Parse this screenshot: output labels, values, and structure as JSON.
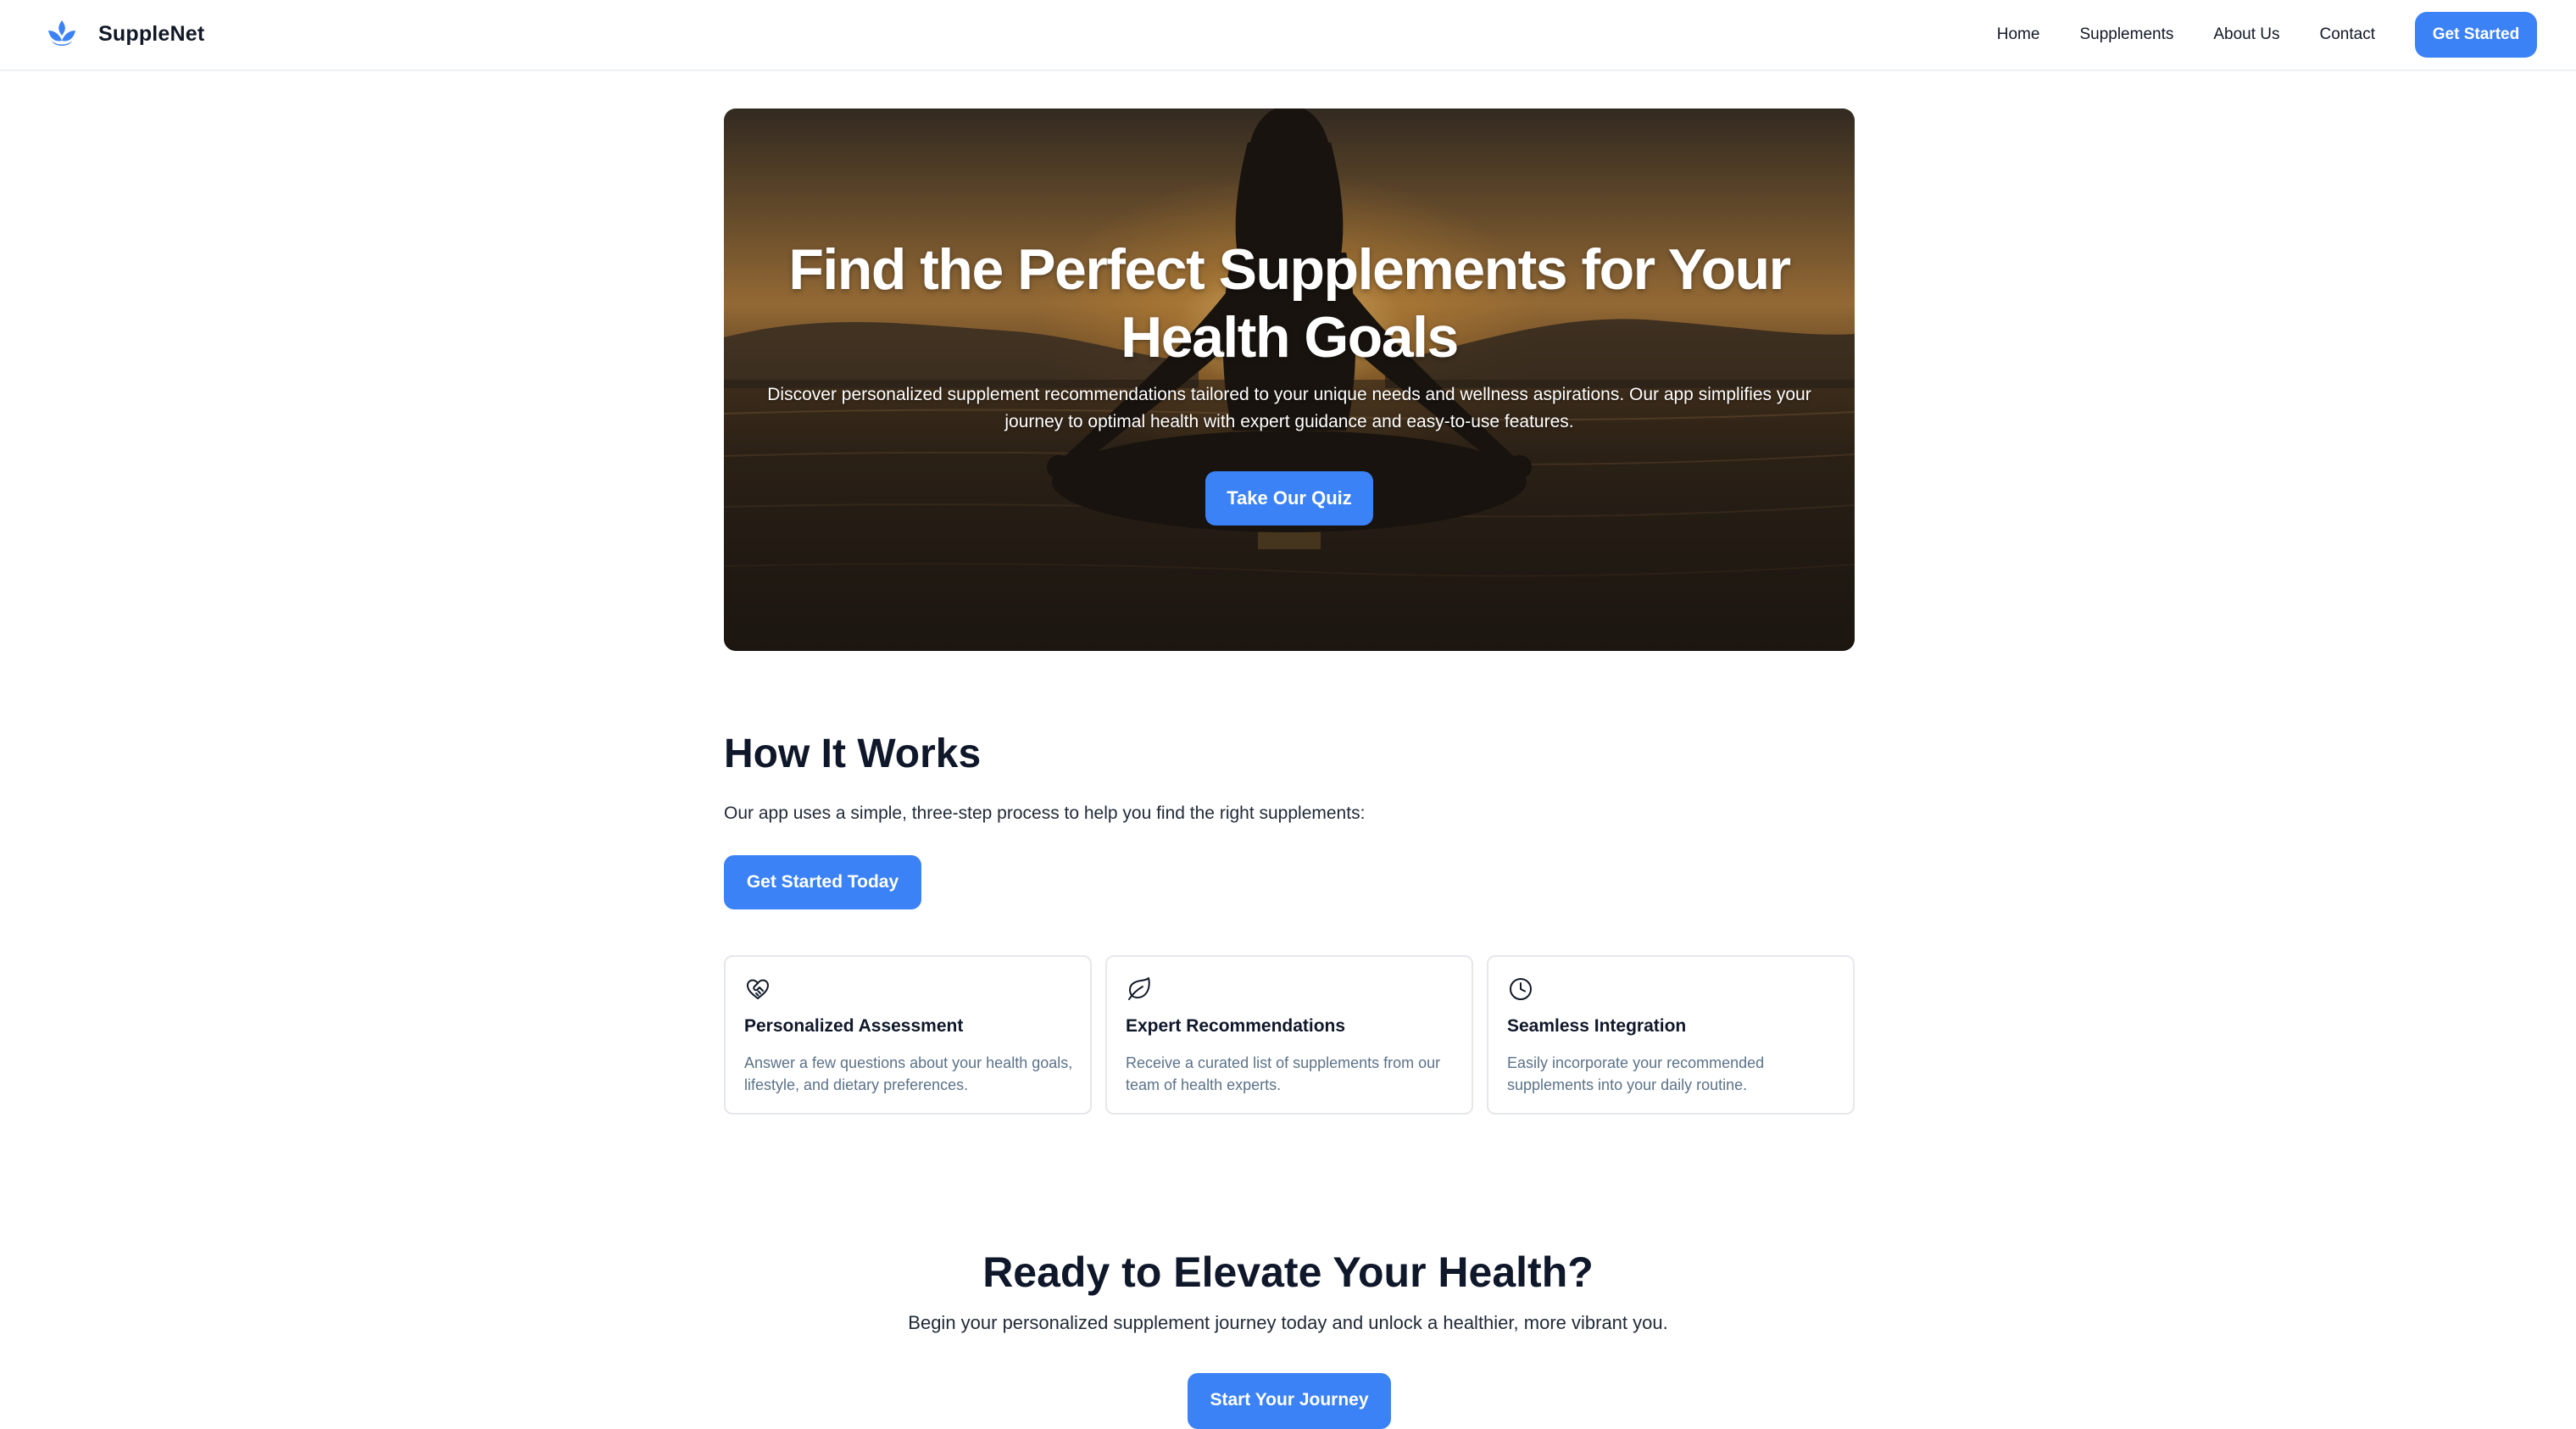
{
  "header": {
    "brand_name": "SuppleNet",
    "brand_icon": "lotus-drop-icon",
    "nav": [
      "Home",
      "Supplements",
      "About Us",
      "Contact"
    ],
    "cta_label": "Get Started"
  },
  "hero": {
    "title": "Find the Perfect Supplements for Your Health Goals",
    "subtitle": "Discover personalized supplement recommendations tailored to your unique needs and wellness aspirations. Our app simplifies your journey to optimal health with expert guidance and easy-to-use features.",
    "button_label": "Take Our Quiz"
  },
  "how": {
    "title": "How It Works",
    "subtitle": "Our app uses a simple, three-step process to help you find the right supplements:",
    "button_label": "Get Started Today",
    "cards": [
      {
        "icon": "heart-handshake-icon",
        "title": "Personalized Assessment",
        "desc": "Answer a few questions about your health goals, lifestyle, and dietary preferences."
      },
      {
        "icon": "leaf-icon",
        "title": "Expert Recommendations",
        "desc": "Receive a curated list of supplements from our team of health experts."
      },
      {
        "icon": "clock-icon",
        "title": "Seamless Integration",
        "desc": "Easily incorporate your recommended supplements into your daily routine."
      }
    ]
  },
  "cta": {
    "title": "Ready to Elevate Your Health?",
    "subtitle": "Begin your personalized supplement journey today and unlock a healthier, more vibrant you.",
    "button_label": "Start Your Journey"
  },
  "colors": {
    "accent": "#3b82f6",
    "text": "#0f172a",
    "muted": "#5b7289",
    "border": "#e5e7eb"
  }
}
